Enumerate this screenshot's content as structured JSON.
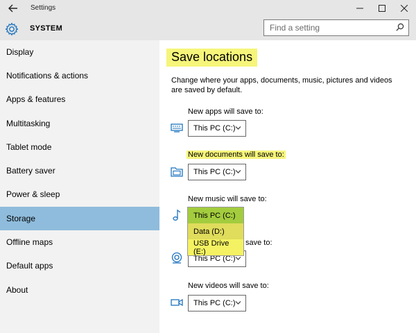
{
  "window": {
    "title": "Settings"
  },
  "header": {
    "section": "SYSTEM",
    "search_placeholder": "Find a setting"
  },
  "sidebar": {
    "items": [
      {
        "label": "Display"
      },
      {
        "label": "Notifications & actions"
      },
      {
        "label": "Apps & features"
      },
      {
        "label": "Multitasking"
      },
      {
        "label": "Tablet mode"
      },
      {
        "label": "Battery saver"
      },
      {
        "label": "Power & sleep"
      },
      {
        "label": "Storage",
        "selected": true
      },
      {
        "label": "Offline maps"
      },
      {
        "label": "Default apps"
      },
      {
        "label": "About"
      }
    ]
  },
  "main": {
    "title": "Save locations",
    "description": "Change where your apps, documents, music, pictures and videos are saved by default.",
    "rows": [
      {
        "label": "New apps will save to:",
        "value": "This PC (C:)",
        "icon": "monitor-icon"
      },
      {
        "label": "New documents will save to:",
        "value": "This PC (C:)",
        "icon": "documents-folder-icon",
        "highlighted": true
      },
      {
        "label": "New music will save to:",
        "value": "This PC (C:)",
        "icon": "music-note-icon"
      },
      {
        "label": "New pictures will save to:",
        "value": "This PC (C:)",
        "icon": "camera-icon",
        "partial_label": "save to:",
        "partial_value": "This PC (C:)"
      },
      {
        "label": "New videos will save to:",
        "value": "This PC (C:)",
        "icon": "video-camera-icon"
      }
    ],
    "open_dropdown": {
      "options": [
        {
          "label": "This PC (C:)",
          "color": "#a3cc3e"
        },
        {
          "label": "Data (D:)",
          "color": "#e0dc5c"
        },
        {
          "label": "USB Drive (E:)",
          "color": "#f4f262"
        }
      ]
    }
  },
  "colors": {
    "highlight_yellow": "#f6f57a",
    "selected_nav": "#8fbcdc",
    "sidebar_bg": "#f2f2f2",
    "titlebar_bg": "#e6e6e6",
    "accent_blue": "#1e73be"
  }
}
